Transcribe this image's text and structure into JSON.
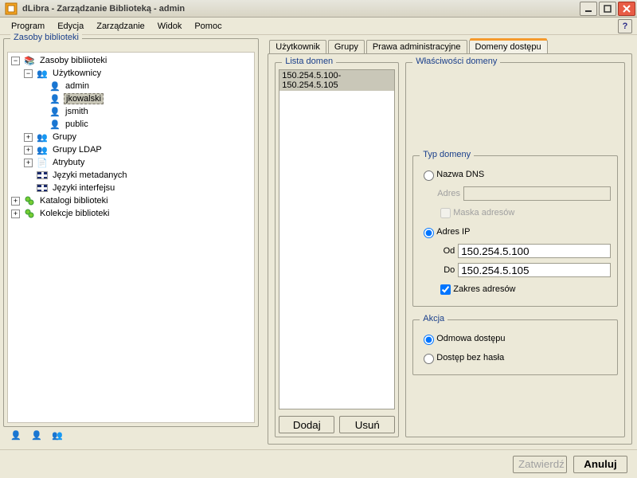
{
  "window": {
    "title": "dLibra - Zarządzanie Biblioteką - admin"
  },
  "menu": {
    "program": "Program",
    "edycja": "Edycja",
    "zarzadzanie": "Zarządzanie",
    "widok": "Widok",
    "pomoc": "Pomoc"
  },
  "left": {
    "legend": "Zasoby biblioteki",
    "tree": {
      "root": "Zasoby bibliioteki",
      "users": "Użytkownicy",
      "user_admin": "admin",
      "user_jkowalski": "jkowalski",
      "user_jsmith": "jsmith",
      "user_public": "public",
      "grupy": "Grupy",
      "grupy_ldap": "Grupy LDAP",
      "atrybuty": "Atrybuty",
      "jezyki_meta": "Języki metadanych",
      "jezyki_interfejsu": "Języki interfejsu",
      "katalogi": "Katalogi biblioteki",
      "kolekcje": "Kolekcje biblioteki"
    }
  },
  "tabs": {
    "uzytkownik": "Użytkownik",
    "grupy": "Grupy",
    "prawa": "Prawa administracyjne",
    "domeny": "Domeny dostępu"
  },
  "domeny": {
    "lista_legend": "Lista domen",
    "lista_item": "150.254.5.100-150.254.5.105",
    "dodaj": "Dodaj",
    "usun": "Usuń",
    "wlasciwosci_legend": "Właściwości domeny",
    "typ_legend": "Typ domeny",
    "nazwa_dns": "Nazwa DNS",
    "adres_label": "Adres",
    "maska": "Maska adresów",
    "adres_ip": "Adres IP",
    "od_label": "Od",
    "do_label": "Do",
    "od_value": "150.254.5.100",
    "do_value": "150.254.5.105",
    "zakres": "Zakres adresów",
    "akcja_legend": "Akcja",
    "odmowa": "Odmowa dostępu",
    "bez_hasla": "Dostęp bez hasła"
  },
  "buttons": {
    "zatwierdz": "Zatwierdź",
    "anuluj": "Anuluj"
  }
}
